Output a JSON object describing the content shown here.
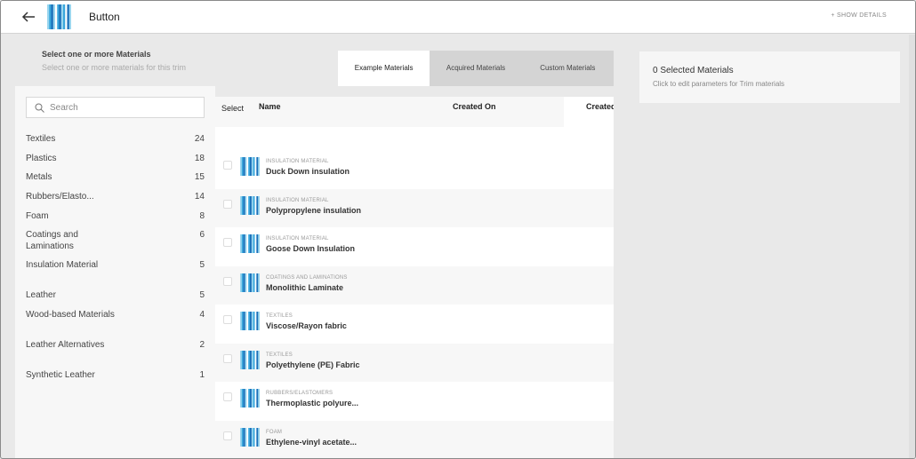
{
  "header": {
    "title": "Button",
    "show_details": "+ SHOW DETAILS"
  },
  "panel": {
    "heading": "Select one or more Materials",
    "subheading": "Select one or more materials for this trim"
  },
  "tabs": [
    {
      "label": "Example Materials",
      "active": true
    },
    {
      "label": "Acquired Materials",
      "active": false
    },
    {
      "label": "Custom Materials",
      "active": false
    }
  ],
  "search": {
    "placeholder": "Search"
  },
  "categories": [
    {
      "name": "Textiles",
      "count": "24"
    },
    {
      "name": "Plastics",
      "count": "18"
    },
    {
      "name": "Metals",
      "count": "15"
    },
    {
      "name": "Rubbers/Elasto...",
      "count": "14"
    },
    {
      "name": "Foam",
      "count": "8"
    },
    {
      "name": "Coatings and Laminations",
      "count": "6"
    },
    {
      "name": "Insulation Material",
      "count": "5"
    },
    {
      "name": "Leather",
      "count": "5"
    },
    {
      "name": "Wood-based Materials",
      "count": "4"
    },
    {
      "name": "Leather Alternatives",
      "count": "2"
    },
    {
      "name": "Synthetic Leather",
      "count": "1"
    }
  ],
  "table": {
    "col_select": "Select",
    "col_name": "Name",
    "col_created_on": "Created On",
    "col_created_by": "Created",
    "rows": [
      {
        "category": "INSULATION MATERIAL",
        "name": "Duck Down insulation"
      },
      {
        "category": "INSULATION MATERIAL",
        "name": "Polypropylene insulation"
      },
      {
        "category": "INSULATION MATERIAL",
        "name": "Goose Down Insulation"
      },
      {
        "category": "COATINGS AND LAMINATIONS",
        "name": "Monolithic Laminate"
      },
      {
        "category": "TEXTILES",
        "name": "Viscose/Rayon fabric"
      },
      {
        "category": "TEXTILES",
        "name": "Polyethylene (PE) Fabric"
      },
      {
        "category": "RUBBERS/ELASTOMERS",
        "name": "Thermoplastic polyure..."
      },
      {
        "category": "FOAM",
        "name": "Ethylene-vinyl acetate..."
      }
    ]
  },
  "selection": {
    "title": "0 Selected Materials",
    "subtitle": "Click to edit parameters for Trim materials"
  },
  "colors": {
    "thumb_dark": "#1a6fb8",
    "thumb_mid": "#3aa7dc",
    "thumb_light": "#9ad6ef"
  }
}
